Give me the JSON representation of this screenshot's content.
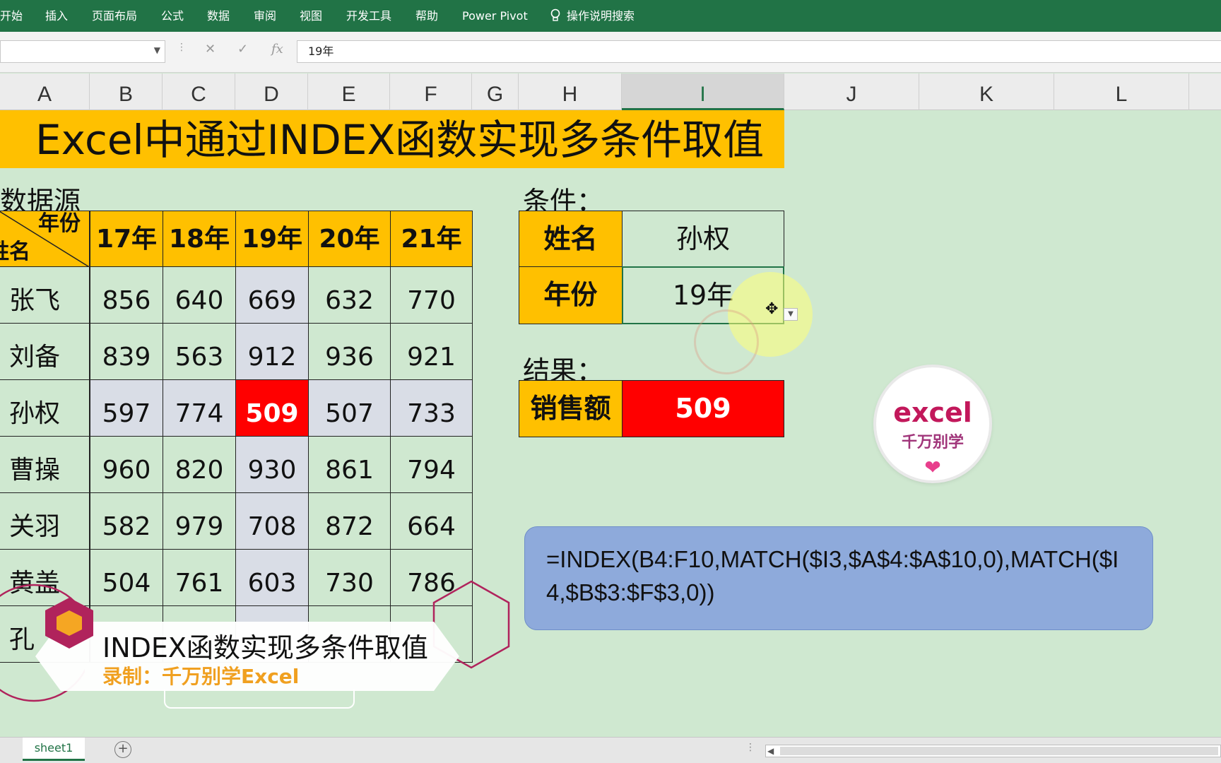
{
  "ribbon": {
    "tabs": [
      "开始",
      "插入",
      "页面布局",
      "公式",
      "数据",
      "审阅",
      "视图",
      "开发工具",
      "帮助",
      "Power Pivot"
    ],
    "search_label": "操作说明搜索"
  },
  "formula_bar": {
    "name_box": "",
    "fx_label": "fx",
    "cancel_icon": "✕",
    "enter_icon": "✓",
    "value": "19年"
  },
  "columns": [
    "A",
    "B",
    "C",
    "D",
    "E",
    "F",
    "G",
    "H",
    "I",
    "J",
    "K",
    "L"
  ],
  "selected_column": "I",
  "title": "Excel中通过INDEX函数实现多条件取值",
  "data_source_label": "数据源",
  "table": {
    "corner_top": "年份",
    "corner_bottom": "姓名",
    "years": [
      "17年",
      "18年",
      "19年",
      "20年",
      "21年"
    ],
    "rows": [
      {
        "name": "张飞",
        "values": [
          "856",
          "640",
          "669",
          "632",
          "770"
        ]
      },
      {
        "name": "刘备",
        "values": [
          "839",
          "563",
          "912",
          "936",
          "921"
        ]
      },
      {
        "name": "孙权",
        "values": [
          "597",
          "774",
          "509",
          "507",
          "733"
        ]
      },
      {
        "name": "曹操",
        "values": [
          "960",
          "820",
          "930",
          "861",
          "794"
        ]
      },
      {
        "name": "关羽",
        "values": [
          "582",
          "979",
          "708",
          "872",
          "664"
        ]
      },
      {
        "name": "黄盖",
        "values": [
          "504",
          "761",
          "603",
          "730",
          "786"
        ]
      },
      {
        "name": "孔",
        "values": [
          "",
          "",
          "",
          "",
          ""
        ]
      }
    ]
  },
  "conditions": {
    "label": "条件：",
    "name_label": "姓名",
    "name_value": "孙权",
    "year_label": "年份",
    "year_value": "19年"
  },
  "result": {
    "label": "结果：",
    "sales_label": "销售额",
    "sales_value": "509"
  },
  "formula_callout": "=INDEX(B4:F10,MATCH($I3,$A$4:$A$10,0),MATCH($I4,$B$3:$F$3,0))",
  "logo": {
    "main": "excel",
    "sub": "千万别学"
  },
  "banner": {
    "title": "INDEX函数实现多条件取值",
    "subtitle": "录制：千万别学Excel"
  },
  "status": {
    "sheet_tab": "sheet1"
  },
  "colors": {
    "accent": "#217346",
    "header_fill": "#ffc000",
    "highlight": "#d9dde6",
    "result_red": "#ff0000",
    "sheet_bg": "#cfe8d0"
  }
}
